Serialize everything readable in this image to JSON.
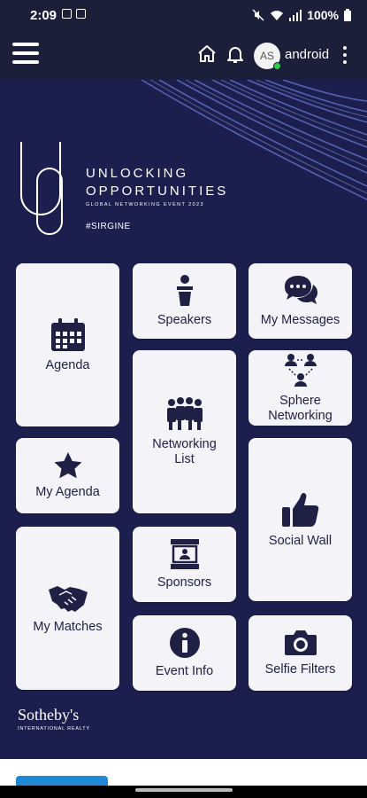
{
  "status_bar": {
    "time": "2:09",
    "battery": "100%"
  },
  "app_bar": {
    "avatar_initials": "AS",
    "username": "android"
  },
  "branding": {
    "title_line1": "UNLOCKING",
    "title_line2": "OPPORTUNITIES",
    "subtitle": "GLOBAL NETWORKING EVENT 2023",
    "hashtag": "#SIRGINE",
    "sponsor_name": "Sotheby's",
    "sponsor_sub": "INTERNATIONAL REALTY"
  },
  "tiles": {
    "agenda": "Agenda",
    "speakers": "Speakers",
    "my_messages": "My Messages",
    "networking_list_1": "Networking",
    "networking_list_2": "List",
    "sphere_networking_1": "Sphere",
    "sphere_networking_2": "Networking",
    "my_agenda": "My Agenda",
    "social_wall": "Social Wall",
    "sponsors": "Sponsors",
    "my_matches": "My Matches",
    "event_info": "Event Info",
    "selfie_filters": "Selfie Filters"
  },
  "icons": [
    "menu-icon",
    "home-icon",
    "bell-icon",
    "calendar-icon",
    "podium-icon",
    "chat-icon",
    "people-group-icon",
    "network-icon",
    "star-icon",
    "thumbs-up-icon",
    "sponsor-booth-icon",
    "handshake-icon",
    "info-icon",
    "camera-icon"
  ],
  "colors": {
    "background": "#1c1f4e",
    "header": "#1b1f3a",
    "tile": "#f4f3f8",
    "tile_text": "#1f2044",
    "online": "#2ecc40"
  }
}
